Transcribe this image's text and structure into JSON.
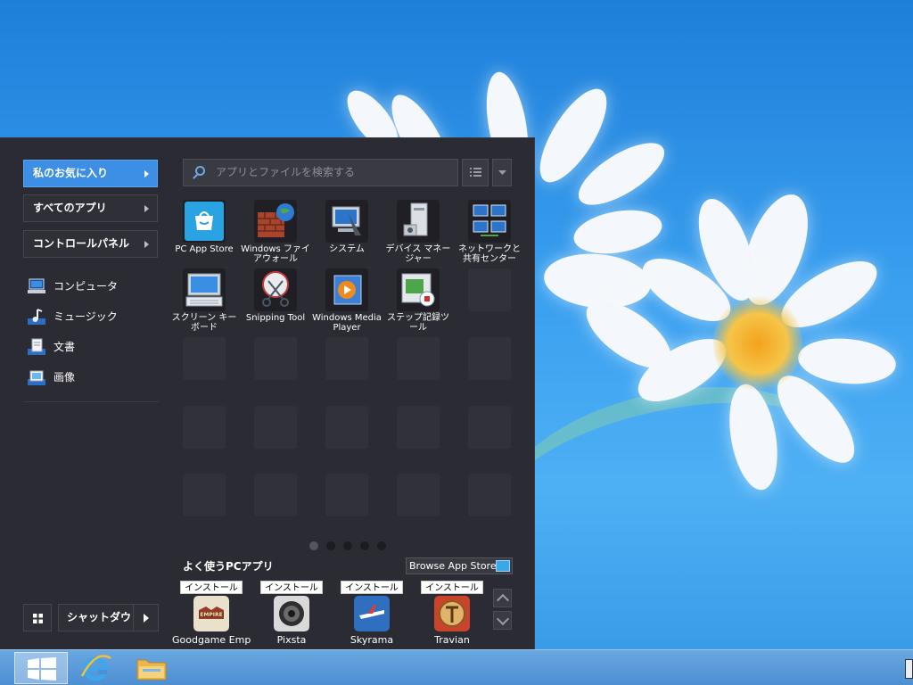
{
  "menu": {
    "nav": [
      {
        "label": "私のお気に入り",
        "active": true
      },
      {
        "label": "すべてのアプリ",
        "active": false
      },
      {
        "label": "コントロールパネル",
        "active": false
      }
    ],
    "places": [
      {
        "label": "コンピュータ",
        "icon": "computer-icon"
      },
      {
        "label": "ミュージック",
        "icon": "music-icon"
      },
      {
        "label": "文書",
        "icon": "documents-icon"
      },
      {
        "label": "画像",
        "icon": "pictures-icon"
      }
    ],
    "search": {
      "placeholder": "アプリとファイルを検索する"
    },
    "tiles": [
      {
        "label": "PC App Store",
        "icon": "pc-app-store-icon"
      },
      {
        "label": "Windows ファイアウォール",
        "icon": "firewall-icon"
      },
      {
        "label": "システム",
        "icon": "system-icon"
      },
      {
        "label": "デバイス マネージャー",
        "icon": "device-manager-icon"
      },
      {
        "label": "ネットワークと共有センター",
        "icon": "network-center-icon"
      },
      {
        "label": "スクリーン キーボード",
        "icon": "screen-keyboard-icon"
      },
      {
        "label": "Snipping Tool",
        "icon": "snipping-tool-icon"
      },
      {
        "label": "Windows Media Player",
        "icon": "media-player-icon"
      },
      {
        "label": "ステップ記録ツール",
        "icon": "steps-recorder-icon"
      }
    ],
    "pages": {
      "count": 5,
      "current": 1
    },
    "frequent": {
      "title": "よく使うPCアプリ",
      "browse_label": "Browse App Store",
      "install_label": "インストール",
      "apps": [
        {
          "name": "Goodgame Emp",
          "icon": "goodgame-empire-icon",
          "color": "#e9e1cc"
        },
        {
          "name": "Pixsta",
          "icon": "pixsta-icon",
          "color": "#d9d9d9"
        },
        {
          "name": "Skyrama",
          "icon": "skyrama-icon",
          "color": "#2f6fc0"
        },
        {
          "name": "Travian",
          "icon": "travian-icon",
          "color": "#c9442b"
        }
      ]
    },
    "shutdown_label": "シャットダウ"
  },
  "colors": {
    "menu_bg": "#2b2b33",
    "accent": "#3d8fe6",
    "taskbar": "#4d8fd3"
  }
}
